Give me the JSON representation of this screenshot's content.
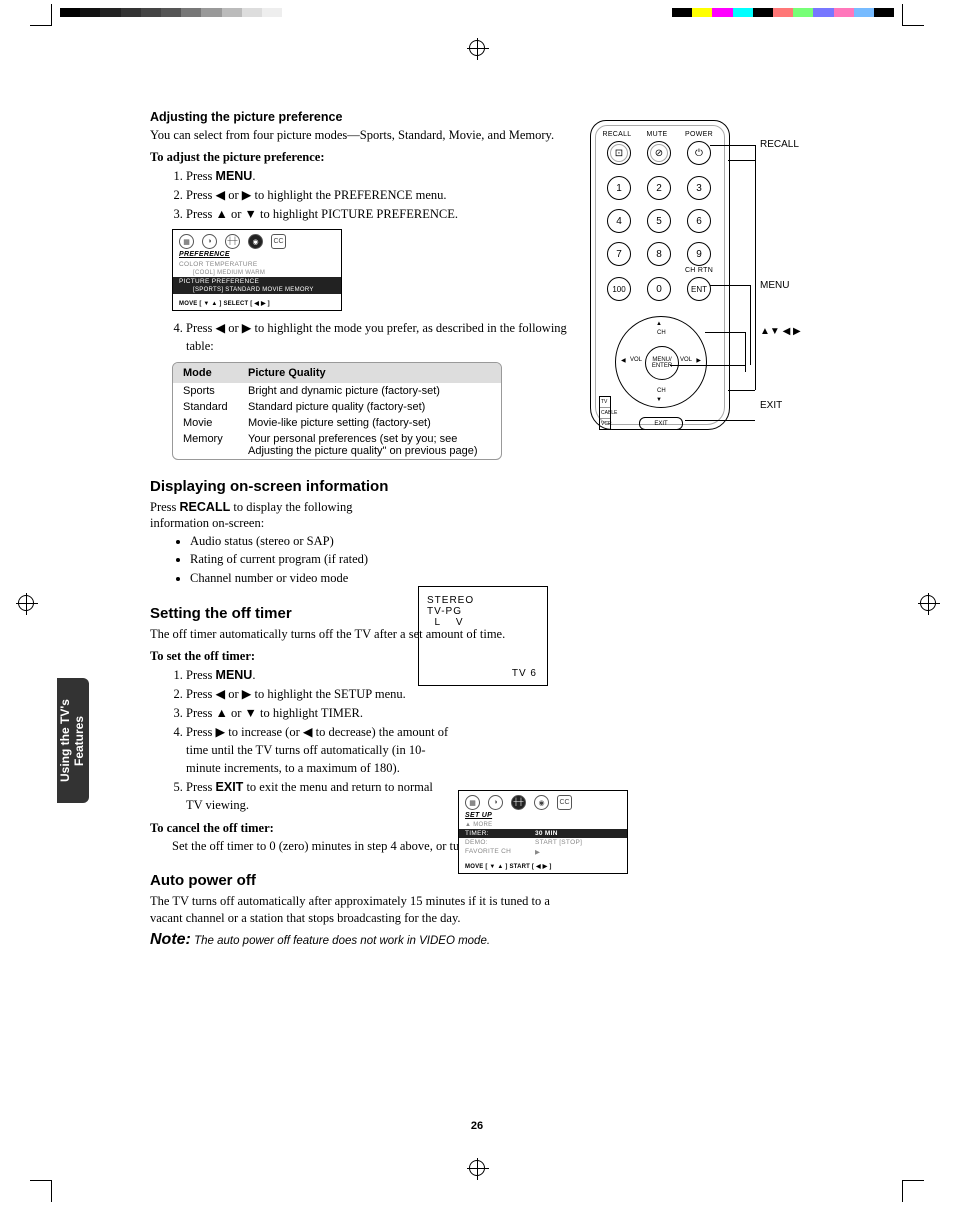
{
  "sideTab": "Using the TV's\nFeatures",
  "sections": {
    "adjustPref": {
      "heading": "Adjusting the picture preference",
      "intro": "You can select from four picture modes—Sports, Standard, Movie, and Memory.",
      "howto": "To adjust the picture preference:",
      "steps": {
        "s1a": "Press ",
        "s1b": "MENU",
        "s1c": ".",
        "s2": "Press ◀ or ▶ to highlight the PREFERENCE menu.",
        "s3": "Press ▲ or ▼ to highlight PICTURE PREFERENCE.",
        "s4": "Press ◀ or ▶ to highlight the mode you prefer, as described in the following table:"
      }
    },
    "osdPref": {
      "title": "PREFERENCE",
      "line1": "COLOR TEMPERATURE",
      "line1b": "[COOL]  MEDIUM  WARM",
      "line2": "PICTURE PREFERENCE",
      "line2b": "[SPORTS] STANDARD   MOVIE   MEMORY",
      "footer": "MOVE [ ▼ ▲ ]      SELECT [ ◀  ▶ ]"
    },
    "modeTable": {
      "h1": "Mode",
      "h2": "Picture Quality",
      "rows": [
        {
          "m": "Sports",
          "q": "Bright and dynamic picture (factory-set)"
        },
        {
          "m": "Standard",
          "q": "Standard picture quality (factory-set)"
        },
        {
          "m": "Movie",
          "q": "Movie-like picture setting  (factory-set)"
        },
        {
          "m": "Memory",
          "q": "Your personal preferences (set by you; see Adjusting the picture quality\" on previous page)"
        }
      ]
    },
    "displayInfo": {
      "heading": "Displaying on-screen information",
      "p1a": "Press ",
      "p1b": "RECALL",
      "p1c": " to display the following information on-screen:",
      "b1": "Audio status (stereo or SAP)",
      "b2": "Rating of current program (if rated)",
      "b3": "Channel number or video mode"
    },
    "recallBox": {
      "l1": "STEREO",
      "l2": "TV-PG",
      "l3": "  L    V",
      "br": "TV  6"
    },
    "offTimer": {
      "heading": "Setting the off timer",
      "intro": "The off timer automatically turns off the TV after a set amount of time.",
      "howto": "To set the off timer:",
      "steps": {
        "s1a": "Press ",
        "s1b": "MENU",
        "s1c": ".",
        "s2": "Press ◀ or ▶ to highlight the SETUP menu.",
        "s3": "Press ▲ or ▼ to highlight TIMER.",
        "s4": "Press ▶ to increase (or ◀ to decrease) the amount of time until the TV turns off automatically (in 10-minute increments, to a maximum of 180).",
        "s5a": "Press ",
        "s5b": "EXIT",
        "s5c": " to exit the menu and return to normal TV viewing."
      },
      "cancelH": "To cancel the off timer:",
      "cancel": "Set the off timer to 0 (zero) minutes in step 4 above, or turn off the TV."
    },
    "osdSetup": {
      "title": "SET UP",
      "more": "▲ MORE",
      "timer": "TIMER:",
      "timerVal": "30 MIN",
      "demo": "DEMO:",
      "demoVal": "START [STOP]",
      "fav": "FAVORITE CH",
      "favVal": "▶",
      "footer": "MOVE [ ▼ ▲ ]       START [ ◀  ▶ ]"
    },
    "autoPower": {
      "heading": "Auto power off",
      "body": "The TV turns off automatically after approximately 15 minutes if it is tuned to a vacant channel or a station that stops broadcasting for the day.",
      "noteLabel": "Note:",
      "note": " The auto power off feature does not work in VIDEO mode."
    }
  },
  "remote": {
    "labels": {
      "recall": "RECALL",
      "mute": "MUTE",
      "power": "POWER",
      "chrtn": "CH RTN"
    },
    "nums": {
      "n1": "1",
      "n2": "2",
      "n3": "3",
      "n4": "4",
      "n5": "5",
      "n6": "6",
      "n7": "7",
      "n8": "8",
      "n9": "9",
      "n0": "0",
      "n100": "100",
      "ent": "ENT"
    },
    "dpad": {
      "ch": "CH",
      "vol": "VOL",
      "menu": "MENU/",
      "enter": "ENTER"
    },
    "switch": {
      "tv": "TV",
      "cable": "CABLE",
      "vcr": "VCR"
    },
    "exit": "EXIT",
    "callouts": {
      "recall": "RECALL",
      "menu": "MENU",
      "arrows": "▲▼ ◀ ▶",
      "exit": "EXIT"
    }
  },
  "pageNum": "26"
}
